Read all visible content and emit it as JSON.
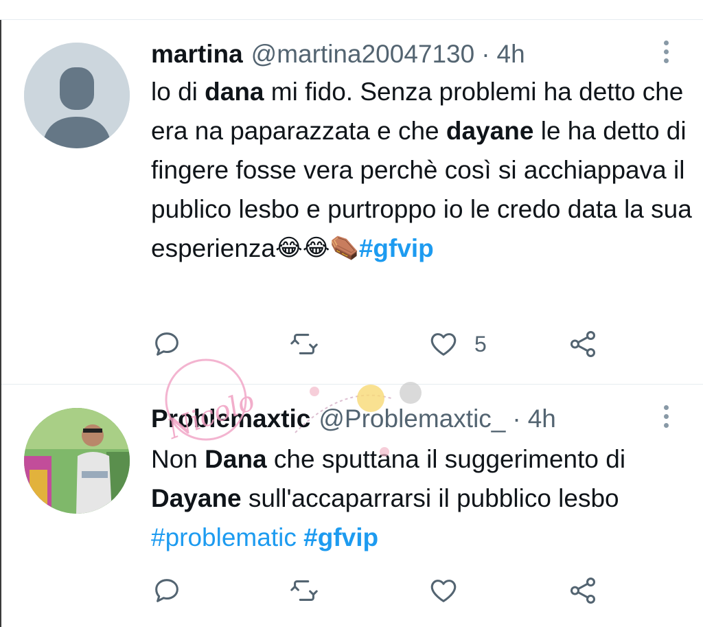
{
  "tweets": [
    {
      "name": "martina",
      "handle": "@martina20047130",
      "separator": "·",
      "time": "4h",
      "segments": [
        {
          "text": "lo di ",
          "style": "normal"
        },
        {
          "text": "dana",
          "style": "bold"
        },
        {
          "text": " mi fido. Senza problemi ha detto che era na paparazzata e che ",
          "style": "normal"
        },
        {
          "text": "dayane",
          "style": "bold"
        },
        {
          "text": " le ha detto di fingere fosse vera perchè così si acchiappava il publico lesbo e purtroppo io le credo data la sua esperienza",
          "style": "normal"
        },
        {
          "text": "😂😂⚰️",
          "style": "emoji"
        },
        {
          "text": "#gfvip",
          "style": "hashtag-bold"
        }
      ],
      "actions": {
        "reply_icon": "reply-icon",
        "retweet_icon": "retweet-icon",
        "like_icon": "like-icon",
        "like_count": "5",
        "share_icon": "share-icon"
      },
      "more_icon": "more-vertical-icon",
      "avatar": "default-avatar-icon"
    },
    {
      "name": "Problemaxtic",
      "handle": "@Problemaxtic_",
      "separator": "·",
      "time": "4h",
      "segments": [
        {
          "text": "Non ",
          "style": "normal"
        },
        {
          "text": "Dana",
          "style": "bold"
        },
        {
          "text": " che sputtana il suggerimento di ",
          "style": "normal"
        },
        {
          "text": "Dayane",
          "style": "bold"
        },
        {
          "text": " sull'accaparrarsi il pubblico lesbo ",
          "style": "normal"
        },
        {
          "text": "#problematic",
          "style": "hashtag"
        },
        {
          "text": " ",
          "style": "normal"
        },
        {
          "text": "#gfvip",
          "style": "hashtag-bold"
        }
      ],
      "actions": {
        "reply_icon": "reply-icon",
        "retweet_icon": "retweet-icon",
        "like_icon": "like-icon",
        "like_count": "",
        "share_icon": "share-icon"
      },
      "more_icon": "more-vertical-icon",
      "avatar": "user-photo-avatar"
    }
  ],
  "watermark": {
    "text": "Nicolo"
  },
  "colors": {
    "link": "#1d9bf0",
    "secondary": "#536471",
    "text": "#0f1419",
    "divider": "#e6ecf0"
  }
}
